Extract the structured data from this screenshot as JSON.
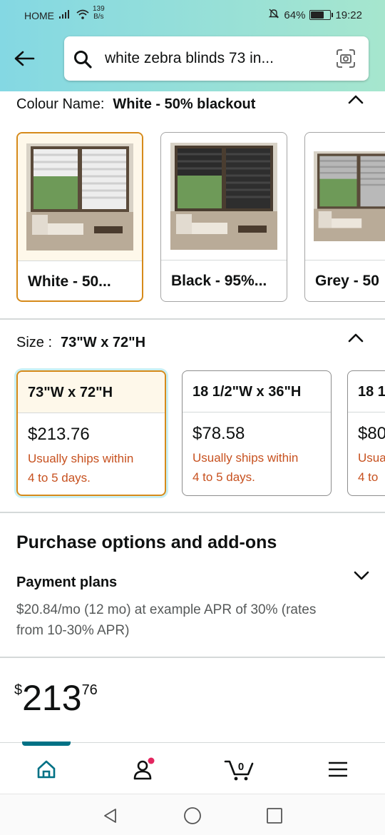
{
  "status_bar": {
    "carrier": "HOME",
    "net_speed_value": "139",
    "net_speed_unit": "B/s",
    "battery": "64%",
    "battery_level": 0.64,
    "time": "19:22"
  },
  "search": {
    "query": "white zebra blinds 73 in..."
  },
  "colour": {
    "label": "Colour Name:",
    "selected": "White - 50% blackout",
    "options": [
      {
        "name": "White - 50..."
      },
      {
        "name": "Black - 95%..."
      },
      {
        "name": "Grey - 50"
      }
    ]
  },
  "size": {
    "label": "Size :",
    "selected": "73\"W x 72\"H",
    "options": [
      {
        "name": "73\"W x 72\"H",
        "price": "$213.76",
        "ship1": "Usually ships within",
        "ship2": "4 to 5 days."
      },
      {
        "name": "18 1/2\"W x 36\"H",
        "price": "$78.58",
        "ship1": "Usually ships within",
        "ship2": "4 to 5 days."
      },
      {
        "name": "18 1",
        "price": "$80",
        "ship1": "Usua",
        "ship2": "4 to"
      }
    ]
  },
  "purchase": {
    "heading": "Purchase options and add-ons",
    "payment_title": "Payment plans",
    "payment_desc": "$20.84/mo (12 mo) at example APR of 30% (rates from 10-30% APR)"
  },
  "price": {
    "symbol": "$",
    "whole": "213",
    "fraction": "76"
  },
  "cart": {
    "count": "0"
  },
  "colors": {
    "accent": "#007185",
    "selected_border": "#d68a1a",
    "ship_text": "#c7511f",
    "badge": "#e3265f"
  }
}
